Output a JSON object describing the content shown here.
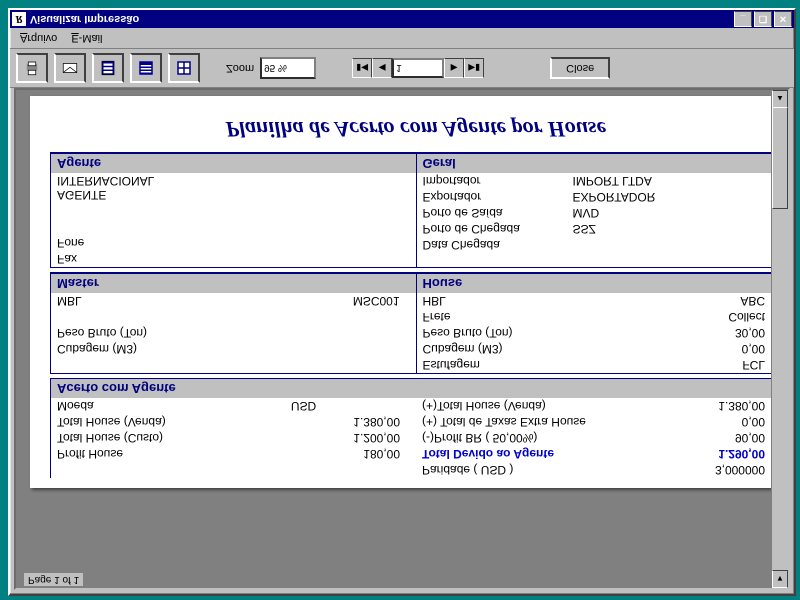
{
  "window": {
    "title": "Visualizar Impressão"
  },
  "menu": {
    "arquivo": "Arquivo",
    "email": "E-Mail"
  },
  "toolbar": {
    "zoom_label": "Zoom",
    "zoom_value": "95 %",
    "page_value": "1",
    "close": "Close"
  },
  "footer": {
    "page": "Page 1 of 1"
  },
  "report": {
    "title": "Planilha de Acerto com Agente por House",
    "agente": {
      "header": "Agente",
      "name": "AGENTE INTERNACIONAL",
      "fone_k": "Fone",
      "fone_v": "",
      "fax_k": "Fax",
      "fax_v": ""
    },
    "geral": {
      "header": "Geral",
      "importador_k": "Importador",
      "importador_v": "IMPORT LTDA",
      "exportador_k": "Exportador",
      "exportador_v": "EXPORTADOR",
      "psaida_k": "Porto de Saída",
      "psaida_v": "MVD",
      "pchegada_k": "Porto de Chegada",
      "pchegada_v": "SSZ",
      "dchegada_k": "Data Chegada",
      "dchegada_v": ""
    },
    "master": {
      "header": "Master",
      "mbl_k": "MBL",
      "mbl_v": "MSC001",
      "peso_k": "Peso Bruto (Ton)",
      "peso_v": "",
      "cub_k": "Cubagem (M3)",
      "cub_v": ""
    },
    "house": {
      "header": "House",
      "hbl_k": "HBL",
      "hbl_v": "ABC",
      "frete_k": "Frete",
      "frete_v": "Collect",
      "peso_k": "Peso Bruto (Ton)",
      "peso_v": "30,00",
      "cub_k": "Cubagem (M3)",
      "cub_v": "0,00",
      "est_k": "Estufagem",
      "est_v": "FCL"
    },
    "acerto": {
      "header": "Acerto com Agente",
      "left": {
        "moeda_k": "Moeda",
        "moeda_v": "USD",
        "thv_k": "Total House (Venda)",
        "thv_v": "1.380,00",
        "thc_k": "Total House (Custo)",
        "thc_v": "1.200,00",
        "ph_k": "Profit House",
        "ph_v": "180,00"
      },
      "right": {
        "thv_k": "(+)Total House (Venda)",
        "thv_v": "1.380,00",
        "tex_k": "(+) Total de Taxas Extra House",
        "tex_v": "0,00",
        "pbr_k": "(-)Profit BR (   50,00%)",
        "pbr_v": "90,00",
        "tda_k": "Total Devido ao Agente",
        "tda_v": "1.290,00",
        "par_k": "Paridade (  USD  )",
        "par_v": "3,000000"
      }
    }
  }
}
